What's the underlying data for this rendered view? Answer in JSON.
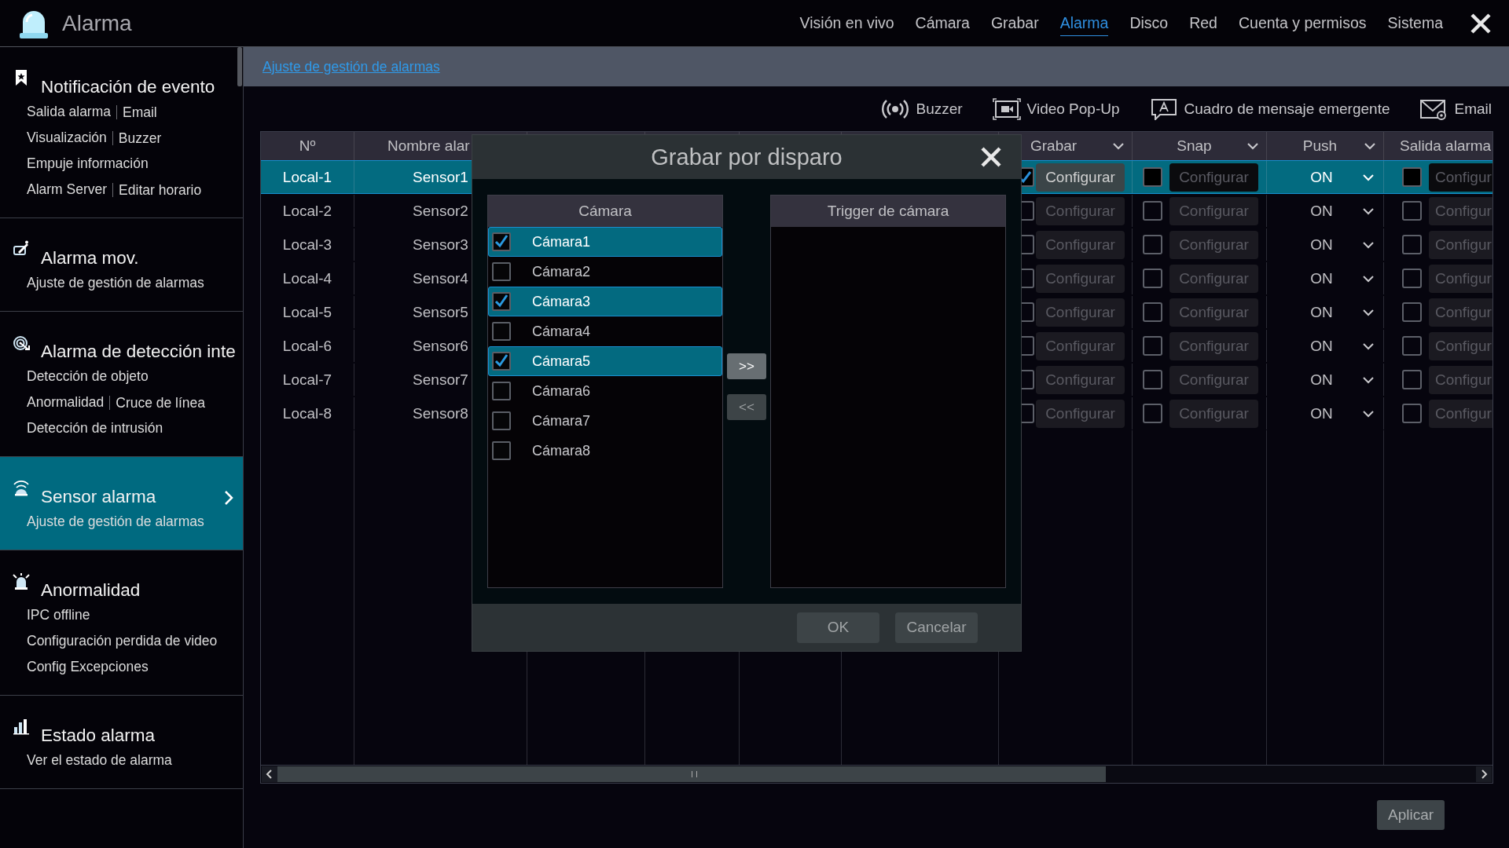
{
  "header": {
    "title": "Alarma",
    "nav": [
      {
        "label": "Visión en vivo",
        "selected": false
      },
      {
        "label": "Cámara",
        "selected": false
      },
      {
        "label": "Grabar",
        "selected": false
      },
      {
        "label": "Alarma",
        "selected": true
      },
      {
        "label": "Disco",
        "selected": false
      },
      {
        "label": "Red",
        "selected": false
      },
      {
        "label": "Cuenta y permisos",
        "selected": false
      },
      {
        "label": "Sistema",
        "selected": false
      }
    ]
  },
  "sidebar": {
    "sections": [
      {
        "kind": "bookmark",
        "title": "Notificación de evento",
        "selected": false,
        "link_rows": [
          [
            "Salida alarma",
            "Email"
          ],
          [
            "Visualización",
            "Buzzer"
          ],
          [
            "Empuje información"
          ],
          [
            "Alarm Server",
            "Editar horario"
          ]
        ]
      },
      {
        "kind": "motion",
        "title": "Alarma mov.",
        "selected": false,
        "link_rows": [
          [
            "Ajuste de gestión de alarmas"
          ]
        ]
      },
      {
        "kind": "target",
        "title": "Alarma de detección inte",
        "selected": false,
        "link_rows": [
          [
            "Detección de objeto"
          ],
          [
            "Anormalidad",
            "Cruce de línea"
          ],
          [
            "Detección de intrusión"
          ]
        ]
      },
      {
        "kind": "sensor",
        "title": "Sensor alarma",
        "selected": true,
        "link_rows": [
          [
            "Ajuste de gestión de alarmas"
          ]
        ]
      },
      {
        "kind": "siren",
        "title": "Anormalidad",
        "selected": false,
        "link_rows": [
          [
            "IPC offline"
          ],
          [
            "Configuración perdida de video"
          ],
          [
            "Config Excepciones"
          ]
        ]
      },
      {
        "kind": "bars",
        "title": "Estado alarma",
        "selected": false,
        "link_rows": [
          [
            "Ver el estado de alarma"
          ]
        ]
      }
    ]
  },
  "breadcrumb": "Ajuste de gestión de alarmas",
  "toolbar": [
    {
      "kind": "buzzer",
      "label": "Buzzer"
    },
    {
      "kind": "popup",
      "label": "Video Pop-Up"
    },
    {
      "kind": "message",
      "label": "Cuadro de mensaje emergente"
    },
    {
      "kind": "email",
      "label": "Email"
    }
  ],
  "table": {
    "columns": {
      "number": "Nº",
      "name": "Nombre alar",
      "grabar": "Grabar",
      "snap": "Snap",
      "push": "Push",
      "salida": "Salida alarma"
    },
    "rows": [
      {
        "selected": true,
        "number": "Local-1",
        "name": "Sensor1",
        "grabar_checked": true,
        "grabar_button": "Configurar",
        "snap_checked": false,
        "snap_button": "Configurar",
        "push": "ON",
        "salida_checked": false,
        "salida_button": "Configur"
      },
      {
        "selected": false,
        "number": "Local-2",
        "name": "Sensor2",
        "grabar_checked": false,
        "grabar_button": "Configurar",
        "snap_checked": false,
        "snap_button": "Configurar",
        "push": "ON",
        "salida_checked": false,
        "salida_button": "Configur"
      },
      {
        "selected": false,
        "number": "Local-3",
        "name": "Sensor3",
        "grabar_checked": false,
        "grabar_button": "Configurar",
        "snap_checked": false,
        "snap_button": "Configurar",
        "push": "ON",
        "salida_checked": false,
        "salida_button": "Configur"
      },
      {
        "selected": false,
        "number": "Local-4",
        "name": "Sensor4",
        "grabar_checked": false,
        "grabar_button": "Configurar",
        "snap_checked": false,
        "snap_button": "Configurar",
        "push": "ON",
        "salida_checked": false,
        "salida_button": "Configur"
      },
      {
        "selected": false,
        "number": "Local-5",
        "name": "Sensor5",
        "grabar_checked": false,
        "grabar_button": "Configurar",
        "snap_checked": false,
        "snap_button": "Configurar",
        "push": "ON",
        "salida_checked": false,
        "salida_button": "Configur"
      },
      {
        "selected": false,
        "number": "Local-6",
        "name": "Sensor6",
        "grabar_checked": false,
        "grabar_button": "Configurar",
        "snap_checked": false,
        "snap_button": "Configurar",
        "push": "ON",
        "salida_checked": false,
        "salida_button": "Configur"
      },
      {
        "selected": false,
        "number": "Local-7",
        "name": "Sensor7",
        "grabar_checked": false,
        "grabar_button": "Configurar",
        "snap_checked": false,
        "snap_button": "Configurar",
        "push": "ON",
        "salida_checked": false,
        "salida_button": "Configur"
      },
      {
        "selected": false,
        "number": "Local-8",
        "name": "Sensor8",
        "grabar_checked": false,
        "grabar_button": "Configurar",
        "snap_checked": false,
        "snap_button": "Configurar",
        "push": "ON",
        "salida_checked": false,
        "salida_button": "Configur"
      }
    ]
  },
  "apply": "Aplicar",
  "dialog": {
    "title": "Grabar por disparo",
    "source": {
      "heading": "Cámara",
      "items": [
        {
          "label": "Cámara1",
          "checked": true,
          "selected": true
        },
        {
          "label": "Cámara2",
          "checked": false,
          "selected": false
        },
        {
          "label": "Cámara3",
          "checked": true,
          "selected": true
        },
        {
          "label": "Cámara4",
          "checked": false,
          "selected": false
        },
        {
          "label": "Cámara5",
          "checked": true,
          "selected": true
        },
        {
          "label": "Cámara6",
          "checked": false,
          "selected": false
        },
        {
          "label": "Cámara7",
          "checked": false,
          "selected": false
        },
        {
          "label": "Cámara8",
          "checked": false,
          "selected": false
        }
      ]
    },
    "transfer_buttons": [
      {
        "label": ">>",
        "disabled": false
      },
      {
        "label": "<<",
        "disabled": true
      }
    ],
    "target": {
      "heading": "Trigger de cámara"
    },
    "ok": "OK",
    "cancel": "Cancelar"
  }
}
